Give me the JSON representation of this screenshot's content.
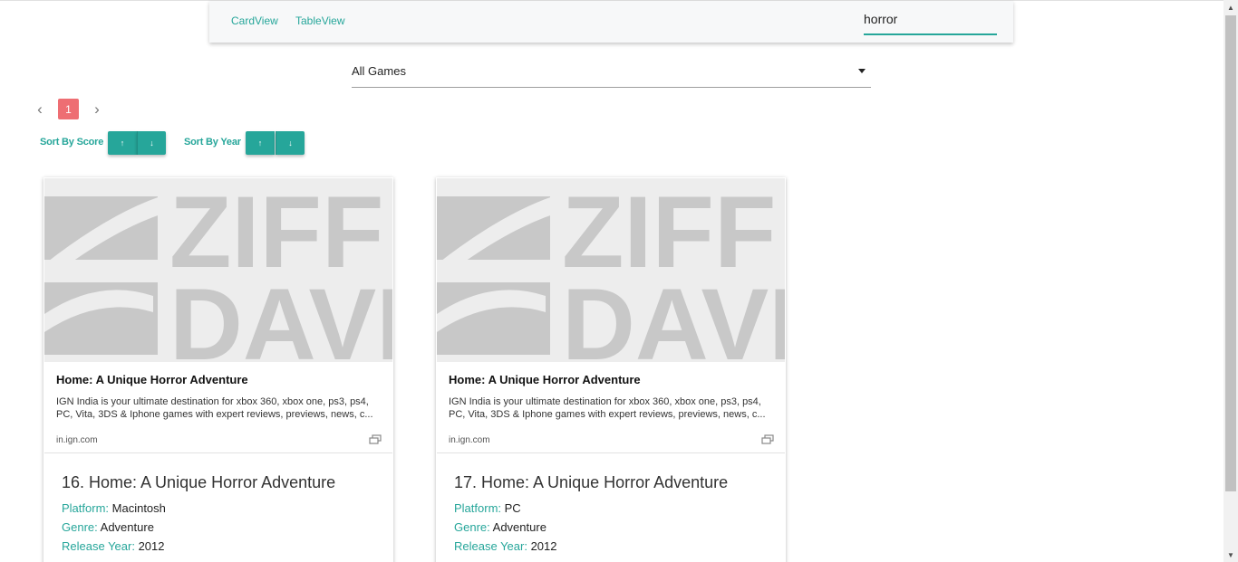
{
  "nav": {
    "card_view": "CardView",
    "table_view": "TableView",
    "search_value": "horror"
  },
  "filter": {
    "selected": "All Games"
  },
  "pagination": {
    "prev": "‹",
    "current": "1",
    "next": "›"
  },
  "sort": {
    "score_label": "Sort By Score",
    "year_label": "Sort By Year",
    "asc_icon": "arrow-up-icon",
    "desc_icon": "arrow-down-icon",
    "asc_glyph": "↑",
    "desc_glyph": "↓"
  },
  "colors": {
    "accent": "#26a69a",
    "page_active": "#ee6e73"
  },
  "cards": [
    {
      "preview": {
        "logo_text": [
          "ZIFF",
          "DAVIS"
        ],
        "title": "Home: A Unique Horror Adventure",
        "description": "IGN India is your ultimate destination for xbox 360, xbox one, ps3, ps4, PC, Vita, 3DS & Iphone games with expert reviews, previews, news, c...",
        "domain": "in.ign.com"
      },
      "title": "16. Home: A Unique Horror Adventure",
      "platform_label": "Platform:",
      "platform": "Macintosh",
      "genre_label": "Genre:",
      "genre": "Adventure",
      "year_label": "Release Year:",
      "year": "2012"
    },
    {
      "preview": {
        "logo_text": [
          "ZIFF",
          "DAVIS"
        ],
        "title": "Home: A Unique Horror Adventure",
        "description": "IGN India is your ultimate destination for xbox 360, xbox one, ps3, ps4, PC, Vita, 3DS & Iphone games with expert reviews, previews, news, c...",
        "domain": "in.ign.com"
      },
      "title": "17. Home: A Unique Horror Adventure",
      "platform_label": "Platform:",
      "platform": "PC",
      "genre_label": "Genre:",
      "genre": "Adventure",
      "year_label": "Release Year:",
      "year": "2012"
    }
  ]
}
